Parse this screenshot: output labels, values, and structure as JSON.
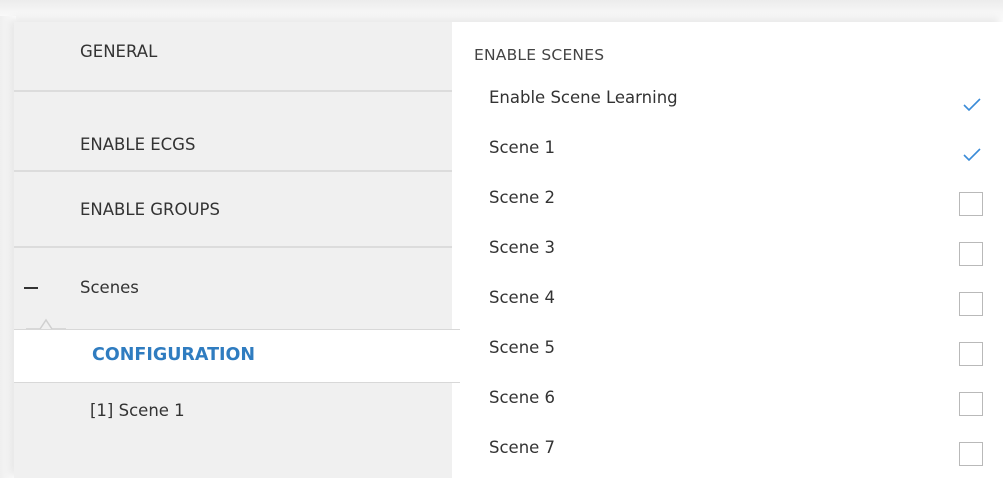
{
  "sidebar": {
    "items": [
      {
        "label": "GENERAL"
      },
      {
        "label": "ENABLE ECGS"
      },
      {
        "label": "ENABLE GROUPS"
      },
      {
        "label": "Scenes"
      }
    ],
    "subitems": [
      {
        "label": "CONFIGURATION",
        "selected": true
      },
      {
        "label": "[1] Scene 1"
      }
    ]
  },
  "main": {
    "section_title": "ENABLE SCENES",
    "params": [
      {
        "label": "Enable Scene Learning",
        "checked": true
      },
      {
        "label": "Scene 1",
        "checked": true
      },
      {
        "label": "Scene 2",
        "checked": false
      },
      {
        "label": "Scene 3",
        "checked": false
      },
      {
        "label": "Scene 4",
        "checked": false
      },
      {
        "label": "Scene 5",
        "checked": false
      },
      {
        "label": "Scene 6",
        "checked": false
      },
      {
        "label": "Scene 7",
        "checked": false
      }
    ]
  },
  "colors": {
    "accent": "#2f7cc0",
    "sidebar_bg": "#f0f0f0",
    "check": "#3a8bd8"
  }
}
